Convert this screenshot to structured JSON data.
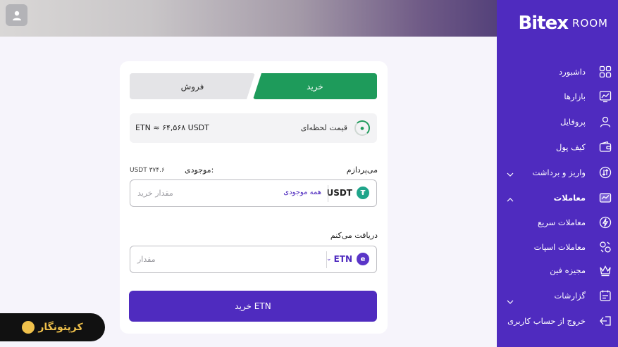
{
  "brand": {
    "name": "Bitex",
    "suffix": "ROOM"
  },
  "colors": {
    "accent": "#4f2bbf",
    "buy": "#1e9b5b",
    "sell": "#e4e4e7",
    "usdt": "#1fa58a",
    "etn": "#5a35c8"
  },
  "sidebar": {
    "items": [
      {
        "label": "داشبورد",
        "icon": "dashboard-icon"
      },
      {
        "label": "بازارها",
        "icon": "markets-icon"
      },
      {
        "label": "پروفایل",
        "icon": "profile-icon"
      },
      {
        "label": "کیف پول",
        "icon": "wallet-icon"
      },
      {
        "label": "واریز و برداشت",
        "icon": "deposit-withdraw-icon",
        "chevron": "down"
      },
      {
        "label": "معاملات",
        "icon": "trades-icon",
        "chevron": "up"
      },
      {
        "label": "معاملات سریع",
        "icon": "quick-trade-icon"
      },
      {
        "label": "معاملات اسپات",
        "icon": "spot-trade-icon"
      },
      {
        "label": "مجیزه فین",
        "icon": "crown-icon"
      },
      {
        "label": "گزارشات",
        "icon": "reports-icon",
        "chevron": "down"
      },
      {
        "label": "خروج از حساب کاربری",
        "icon": "logout-icon"
      }
    ]
  },
  "trade": {
    "tabs": {
      "buy": "خرید",
      "sell": "فروش"
    },
    "price_label": "قیمت لحظه‌ای",
    "price_value": "ETN ≈ ۶۴,۵۶۸ USDT",
    "pay_label": "می‌پردازم",
    "balance_label": "موجودی:",
    "balance_value": "USDT ۳۷۴.۶",
    "pay_currency": "USDT",
    "all_balance": "همه موجودی",
    "pay_placeholder": "مقدار خرید",
    "receive_label": "دریافت می‌کنم",
    "receive_currency": "ETN",
    "receive_placeholder": "مقدار",
    "buy_button": "خرید ETN"
  },
  "watermark": {
    "text": "کرپتونگار"
  }
}
